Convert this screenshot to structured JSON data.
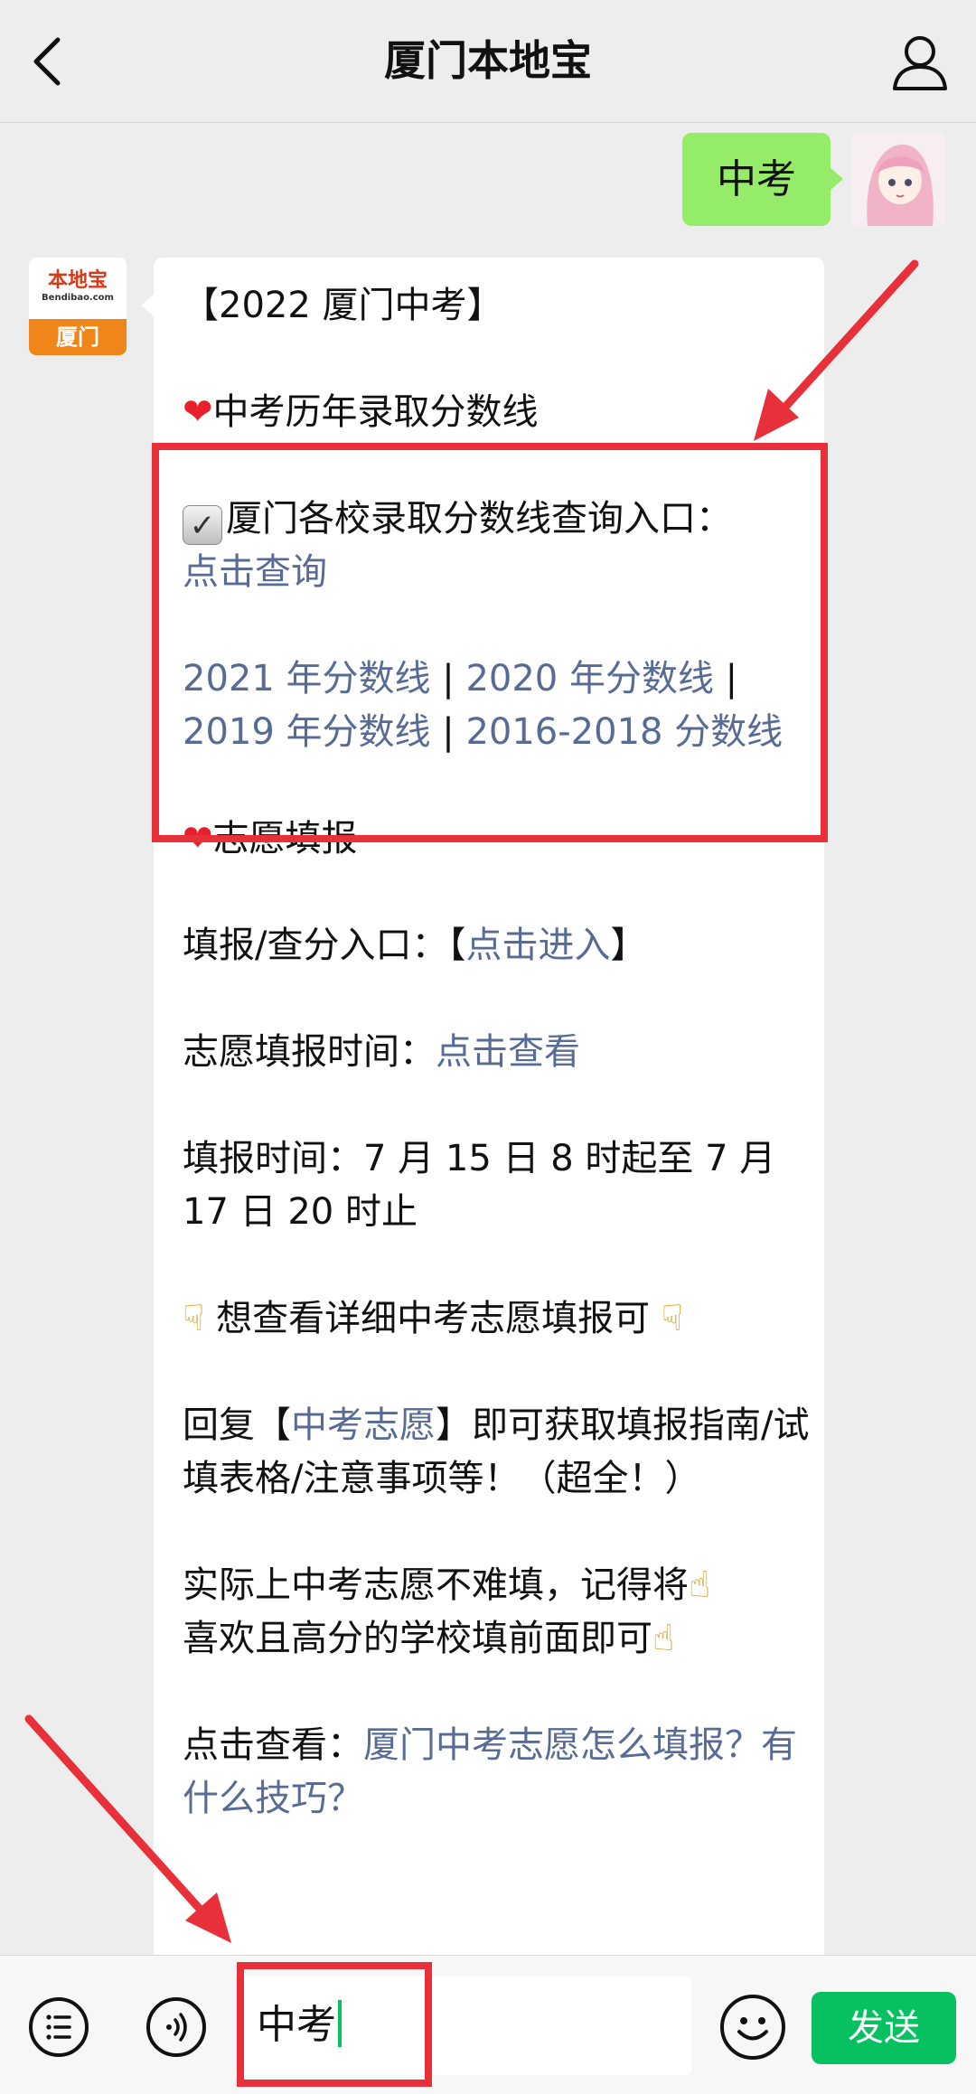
{
  "header": {
    "title": "厦门本地宝"
  },
  "user_message": {
    "text": "中考"
  },
  "bot_avatar": {
    "brand": "本地宝",
    "domain": "Bendibao.com",
    "city": "厦门"
  },
  "bot_message": {
    "heading": "【2022 厦门中考】",
    "section1_title": "中考历年录取分数线",
    "query_label": "厦门各校录取分数线查询入口：",
    "query_link": "点击查询",
    "year_links": [
      "2021 年分数线",
      "2020 年分数线",
      "2019 年分数线",
      "2016-2018 分数线"
    ],
    "separator": "|",
    "section2_title": "志愿填报",
    "entry_label": "填报/查分入口：",
    "entry_link_open": "【",
    "entry_link": "点击进入",
    "entry_link_close": "】",
    "time_label": "志愿填报时间：",
    "time_link": "点击查看",
    "fill_time": "填报时间：7 月 15 日 8 时起至 7 月 17 日 20 时止",
    "hint": "想查看详细中考志愿填报可",
    "reply_prefix": "回复【",
    "reply_keyword": "中考志愿",
    "reply_suffix": "】即可获取填报指南/试填表格/注意事项等！（超全！）",
    "tip": "实际上中考志愿不难填，记得将",
    "tip2": "喜欢且高分的学校填前面即可",
    "view_label": "点击查看：",
    "view_link": "厦门中考志愿怎么填报？有什么技巧？"
  },
  "input_bar": {
    "value": "中考",
    "send_label": "发送"
  },
  "icons": [
    "back-icon",
    "profile-icon",
    "heart-icon",
    "checkbox-icon",
    "hand-icon",
    "menu-icon",
    "voice-icon",
    "emoji-icon"
  ],
  "colors": {
    "accent": "#07c160",
    "bubble_user": "#95ec69",
    "link": "#576b95",
    "highlight": "#e8303b"
  }
}
